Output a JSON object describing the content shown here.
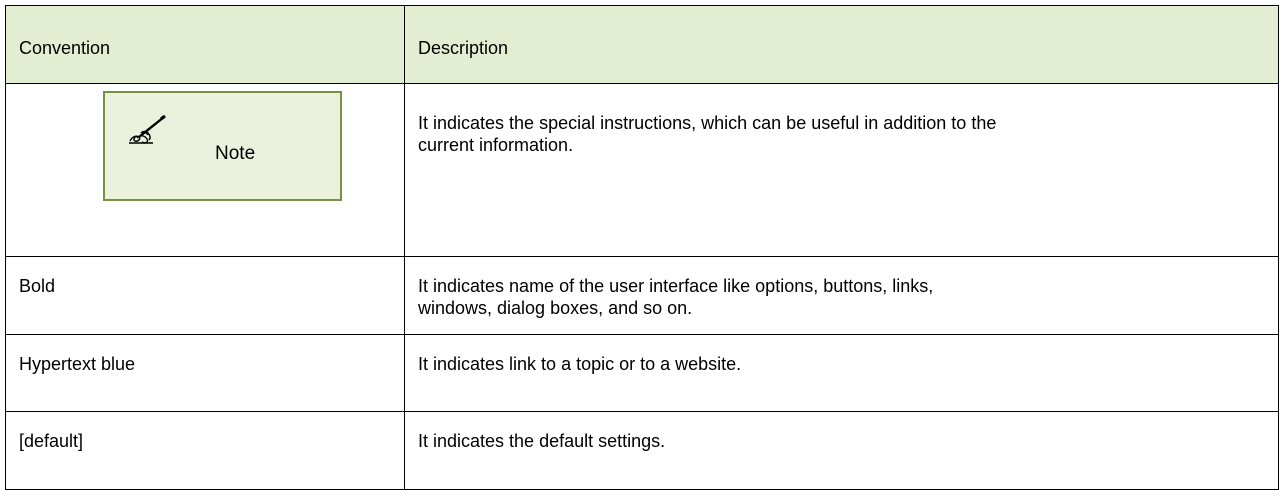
{
  "table": {
    "headers": {
      "convention": "Convention",
      "description": "Description"
    },
    "rows": [
      {
        "convention_icon": "pen-writing-icon",
        "convention": "Note",
        "description_line1": "It indicates the special instructions, which can be useful in addition to the",
        "description_line2": "current information."
      },
      {
        "convention": "Bold",
        "description_line1": "It indicates name of the user interface like options, buttons, links,",
        "description_line2": "windows, dialog boxes, and so on."
      },
      {
        "convention": "Hypertext blue",
        "description_line1": "It indicates link to a topic or to a website."
      },
      {
        "convention": "[default]",
        "description_line1": "It indicates the default settings."
      }
    ]
  },
  "colors": {
    "header_background": "#e3edd1",
    "note_background": "#ebf1dd",
    "note_border": "#76923c"
  }
}
